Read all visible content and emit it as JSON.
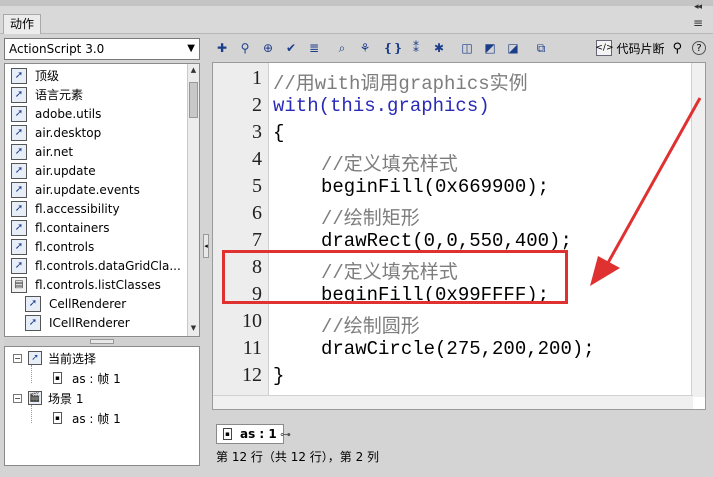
{
  "panel": {
    "tab_label": "动作",
    "collapse_glyph": "◂◂",
    "menu_glyph": "≡"
  },
  "left": {
    "version": "ActionScript 3.0",
    "tree_items": [
      {
        "label": "顶级",
        "icon": "book-arrow-icon",
        "indent": 0
      },
      {
        "label": "语言元素",
        "icon": "book-arrow-icon",
        "indent": 0
      },
      {
        "label": "adobe.utils",
        "icon": "book-arrow-icon",
        "indent": 0
      },
      {
        "label": "air.desktop",
        "icon": "book-arrow-icon",
        "indent": 0
      },
      {
        "label": "air.net",
        "icon": "book-arrow-icon",
        "indent": 0
      },
      {
        "label": "air.update",
        "icon": "book-arrow-icon",
        "indent": 0
      },
      {
        "label": "air.update.events",
        "icon": "book-arrow-icon",
        "indent": 0
      },
      {
        "label": "fl.accessibility",
        "icon": "book-arrow-icon",
        "indent": 0
      },
      {
        "label": "fl.containers",
        "icon": "book-arrow-icon",
        "indent": 0
      },
      {
        "label": "fl.controls",
        "icon": "book-arrow-icon",
        "indent": 0
      },
      {
        "label": "fl.controls.dataGridCla...",
        "icon": "book-arrow-icon",
        "indent": 0
      },
      {
        "label": "fl.controls.listClasses",
        "icon": "open-book-icon",
        "indent": 0
      },
      {
        "label": "CellRenderer",
        "icon": "book-arrow-icon",
        "indent": 1
      },
      {
        "label": "ICellRenderer",
        "icon": "book-arrow-icon",
        "indent": 1
      }
    ],
    "scene_tree": {
      "current_selection": "当前选择",
      "current_frame": "as : 帧 1",
      "scene": "场景 1",
      "scene_frame": "as : 帧 1"
    }
  },
  "toolbar": {
    "buttons": [
      "add-item-icon",
      "find-icon",
      "target-path-icon",
      "check-syntax-icon",
      "auto-format-icon",
      "code-hint-icon",
      "debug-options-icon",
      "collapse-braces-icon",
      "collapse-selection-icon",
      "expand-all-icon",
      "apply-block-comment-icon",
      "apply-line-comment-icon",
      "remove-comment-icon",
      "show-hide-toolbox-icon"
    ],
    "snippets_label": "代码片断",
    "help_glyph": "?"
  },
  "editor": {
    "lines": [
      {
        "n": "1",
        "text": "//用with调用graphics实例",
        "cls": "cmt",
        "indent": 0
      },
      {
        "n": "2",
        "text": "with(this.graphics)",
        "cls": "kw",
        "indent": 0
      },
      {
        "n": "3",
        "text": "{",
        "cls": "blk",
        "indent": 0
      },
      {
        "n": "4",
        "text": "//定义填充样式",
        "cls": "cmt",
        "indent": 1
      },
      {
        "n": "5",
        "text": "beginFill(0x669900);",
        "cls": "blk",
        "indent": 1
      },
      {
        "n": "6",
        "text": "//绘制矩形",
        "cls": "cmt",
        "indent": 1
      },
      {
        "n": "7",
        "text": "drawRect(0,0,550,400);",
        "cls": "blk",
        "indent": 1
      },
      {
        "n": "8",
        "text": "//定义填充样式",
        "cls": "cmt",
        "indent": 1
      },
      {
        "n": "9",
        "text": "beginFill(0x99FFFF);",
        "cls": "blk",
        "indent": 1
      },
      {
        "n": "10",
        "text": "//绘制圆形",
        "cls": "cmt",
        "indent": 1
      },
      {
        "n": "11",
        "text": "drawCircle(275,200,200);",
        "cls": "blk",
        "indent": 1
      },
      {
        "n": "12",
        "text": "}",
        "cls": "blk",
        "indent": 0
      }
    ]
  },
  "file_tab": "as : 1",
  "status": "第 12 行（共 12 行），第 2 列",
  "colors": {
    "highlight": "#e03131",
    "comment": "#7d7d7d",
    "keyword": "#2a2ab8"
  }
}
